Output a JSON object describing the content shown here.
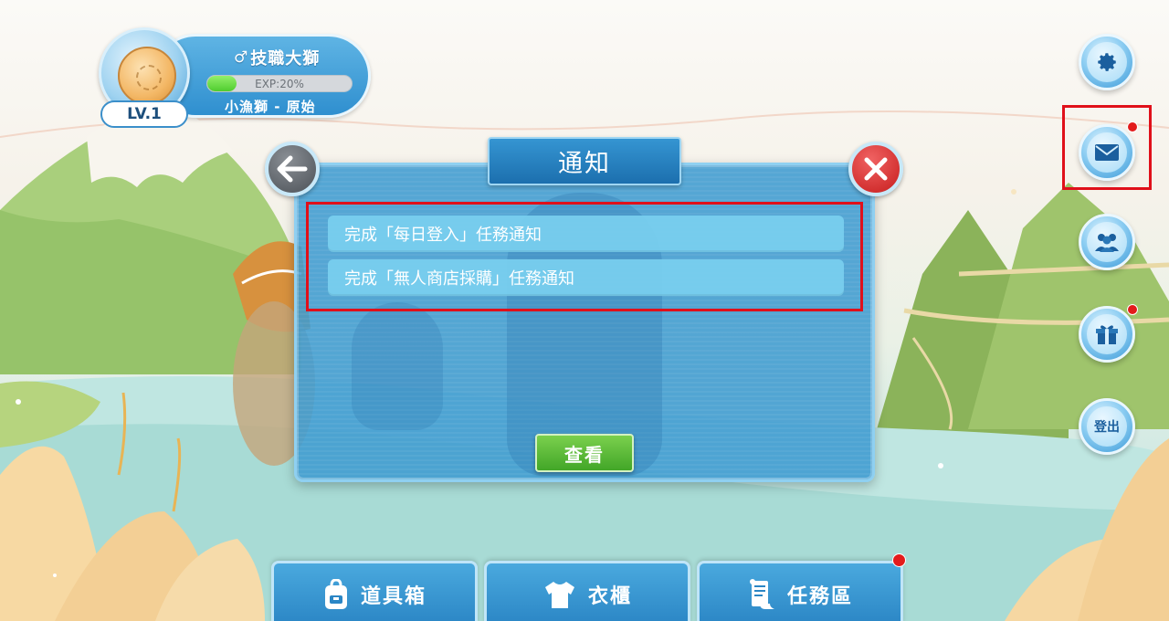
{
  "profile": {
    "name": "技職大獅",
    "exp_text": "EXP:20%",
    "exp_fraction": 0.2,
    "title": "小漁獅 - 原始",
    "level": "LV.1"
  },
  "side_buttons": {
    "settings_icon": "gear-icon",
    "mail_icon": "mail-icon",
    "friends_icon": "friends-icon",
    "gift_icon": "gift-icon",
    "logout_label": "登出"
  },
  "dialog": {
    "title": "通知",
    "notifications": [
      {
        "text": "完成「每日登入」任務通知"
      },
      {
        "text": "完成「無人商店採購」任務通知"
      }
    ],
    "view_button": "查看"
  },
  "bottom_tabs": [
    {
      "label": "道具箱",
      "icon": "backpack-icon"
    },
    {
      "label": "衣櫃",
      "icon": "tshirt-icon"
    },
    {
      "label": "任務區",
      "icon": "scroll-icon"
    }
  ],
  "colors": {
    "accent_blue": "#2f8fcf",
    "notification_dot": "#e31b1b",
    "highlight_red": "#e0101a",
    "view_green": "#42a628"
  }
}
